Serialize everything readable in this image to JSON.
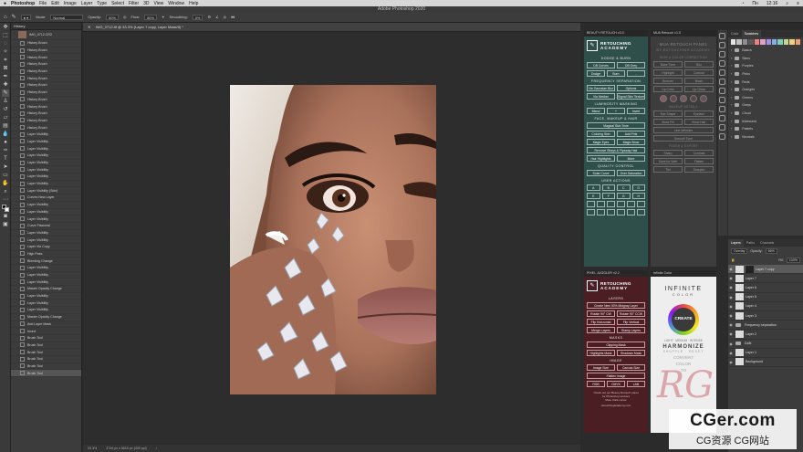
{
  "menubar": {
    "items": [
      "Photoshop",
      "File",
      "Edit",
      "Image",
      "Layer",
      "Type",
      "Select",
      "Filter",
      "3D",
      "View",
      "Window",
      "Help"
    ],
    "day": "Пн",
    "time": "12:16"
  },
  "window_title": "Adobe Photoshop 2020",
  "options": {
    "mode_label": "Mode:",
    "mode_value": "Normal",
    "opacity_label": "Opacity:",
    "opacity_value": "50%",
    "flow_label": "Flow:",
    "flow_value": "80%",
    "smoothing_label": "Smoothing:",
    "smoothing_value": "0%"
  },
  "history": {
    "tab": "History",
    "snapshot": "IMG_0712.CR2",
    "items": [
      "History Brush",
      "History Brush",
      "History Brush",
      "History Brush",
      "History Brush",
      "History Brush",
      "History Brush",
      "History Brush",
      "History Brush",
      "History Brush",
      "History Brush",
      "History Brush",
      "History Brush",
      "Layer Visibility",
      "Layer Visibility",
      "Layer Visibility",
      "Layer Visibility",
      "Layer Visibility",
      "Layer Visibility",
      "Layer Visibility",
      "Layer Visibility",
      "Layer Visibility (Skin)",
      "Curves New Layer",
      "Layer Visibility",
      "Layer Visibility",
      "Layer Visibility",
      "Curve Fissional",
      "Layer Visibility",
      "Layer Visibility",
      "Layer Via Copy",
      "High Pass",
      "Blending Change",
      "Layer Visibility",
      "Layer Visibility",
      "Layer Visibility",
      "Master Opacity Change",
      "Layer Visibility",
      "Layer Visibility",
      "Layer Visibility",
      "Master Opacity Change",
      "Add Layer Mask",
      "Invert",
      "Brush Tool",
      "Brush Tool",
      "Brush Tool",
      "Brush Tool",
      "Brush Tool",
      "Brush Tool"
    ]
  },
  "document": {
    "tab": "IMG_0712.tif @ 33.3% (Layer 7 copy, Layer Mask/8) *",
    "zoom": "33.3%",
    "dimensions": "3744 px x 5616 px (300 ppi)"
  },
  "beauty_panel": {
    "title": "BEAUTY RETOUCH v3.0",
    "logo": [
      "RETOUCHING",
      "ACADEMY"
    ],
    "sections": {
      "dodge": "DODGE & BURN",
      "frequency": "FREQUENCY SEPARATION",
      "luminosity": "LUMINOSITY MASKING",
      "face": "FACE, MAKEUP & HAIR",
      "quality": "QUALITY CONTROL",
      "user": "USER ACTIONS"
    },
    "dodge_buttons": [
      [
        "DB Curves",
        "DB Grey"
      ],
      [
        "Dodge",
        "Burn",
        "-"
      ]
    ],
    "frequency_buttons": [
      [
        "Via Gaussian Blur",
        "Options"
      ],
      [
        "Via Median",
        "Signal Skin Texture"
      ]
    ],
    "luminosity_buttons": [
      "Blend",
      "+",
      "Invert"
    ],
    "face_buttons": [
      [
        "Magical Skin Tone"
      ],
      [
        "Coloring Skin",
        "Add Pink"
      ],
      [
        "Magic Eyes",
        "Magic Brow"
      ],
      [
        "Remove Strays & Flyaway Hair"
      ],
      [
        "Hair Highlights",
        "More"
      ]
    ],
    "quality_buttons": [
      [
        "Solar Curve",
        "Over Saturation"
      ]
    ],
    "user_letters": [
      "A",
      "B",
      "C",
      "D",
      "E",
      "F",
      "G",
      "H"
    ]
  },
  "mua_panel": {
    "title": "MUA Retouch v1.0",
    "heading": "MUA RETOUCH PANEL",
    "sub": "BY RETOUCHING ACADEMY",
    "sections": [
      "SKIN & COLOR CORRECTION",
      "MAKEUP DETAILS",
      "FINISH & EXPORT"
    ],
    "buttons": [
      [
        "Base Tone",
        "Blur"
      ],
      [
        "Highlight",
        "Contour"
      ],
      [
        "Bronzer",
        "Blush"
      ],
      [
        "Lip Color",
        "Lip Gloss"
      ],
      [
        "Eye Shape",
        "Eyelash"
      ],
      [
        "Brow Fill",
        "Brow Hair"
      ],
      [
        "Line Wrinkles"
      ],
      [
        "Smooth Tone"
      ],
      [
        "Sharp",
        "Contrast"
      ],
      [
        "Save for Web",
        "Flatten"
      ],
      [
        "Tint",
        "Sharpen"
      ]
    ]
  },
  "pixel_panel": {
    "title": "PIXEL JUGGLER v2.2",
    "logo": [
      "RETOUCHING",
      "ACADEMY"
    ],
    "sections": {
      "layers": "LAYERS",
      "masks": "MASKS",
      "image": "IMAGE"
    },
    "layer_buttons": [
      [
        "Create New 50% Midgray Layer"
      ],
      [
        "Rotate 90° CW",
        "Rotate 90° CCW"
      ],
      [
        "Flip Horizontal",
        "Flip Vertical"
      ],
      [
        "Merge Layers",
        "Stamp Layers"
      ]
    ],
    "mask_buttons": [
      [
        "Clipping Mask"
      ],
      [
        "Highlights Mask",
        "Shadows Mask"
      ]
    ],
    "image_buttons": [
      [
        "Image Size",
        "Canvas Size"
      ],
      [
        "Flatten Image"
      ],
      [
        "RGB",
        "CMYK",
        "LAB"
      ]
    ],
    "footer": [
      "Check out our Beauty Retouch panel",
      "for Photoshop workers",
      "More Click cursor"
    ],
    "url": "retouchingacademy.com"
  },
  "infinite_panel": {
    "title": "Infinite Color",
    "brand": "INFINITE",
    "brand_sub": "COLOR",
    "create": "CREATE",
    "levels": "LIGHT · MEDIUM · INTENSE",
    "harmonize": "HARMONIZE",
    "shuffle": "SHUFFLE · RESET",
    "convert": "CONVERT",
    "color_word": "COLOR",
    "to": "TO"
  },
  "swatches": {
    "tabs": [
      "Color",
      "Swatches"
    ],
    "folders": [
      "Basics",
      "Skins",
      "Purples",
      "Pinks",
      "Reds",
      "Oranges",
      "Greens",
      "Greys",
      "Cloud",
      "Iridescent",
      "Pastels",
      "Neutrals"
    ],
    "colors": [
      "#e6e6e6",
      "#c0c0c0",
      "#8f8f8f",
      "#5a5a5a",
      "#f08080",
      "#e0a0c8",
      "#a090e0",
      "#80b0e8",
      "#80d0c0",
      "#c0d890",
      "#f0d080",
      "#f0a070"
    ]
  },
  "layers": {
    "tabs": [
      "Layers",
      "Paths",
      "Channels"
    ],
    "blend": "Overlay",
    "opacity_label": "Opacity:",
    "opacity": "66%",
    "fill_label": "Fill:",
    "fill": "100%",
    "items": [
      {
        "name": "Layer 7 copy",
        "kind": "mask",
        "selected": true
      },
      {
        "name": "Layer 7",
        "kind": "thumb"
      },
      {
        "name": "Layer 6",
        "kind": "thumb"
      },
      {
        "name": "Layer 5",
        "kind": "thumb"
      },
      {
        "name": "Layer 4",
        "kind": "thumb"
      },
      {
        "name": "Layer 3",
        "kind": "thumb"
      },
      {
        "name": "Frequency separation",
        "kind": "folder"
      },
      {
        "name": "Layer 2",
        "kind": "thumb"
      },
      {
        "name": "D&B",
        "kind": "folder"
      },
      {
        "name": "Layer 1",
        "kind": "thumb"
      },
      {
        "name": "Background",
        "kind": "thumb"
      }
    ]
  },
  "watermark": {
    "line1": "CGer.com",
    "line2": "CG资源 CG网站"
  },
  "overlay_monogram": "RG"
}
